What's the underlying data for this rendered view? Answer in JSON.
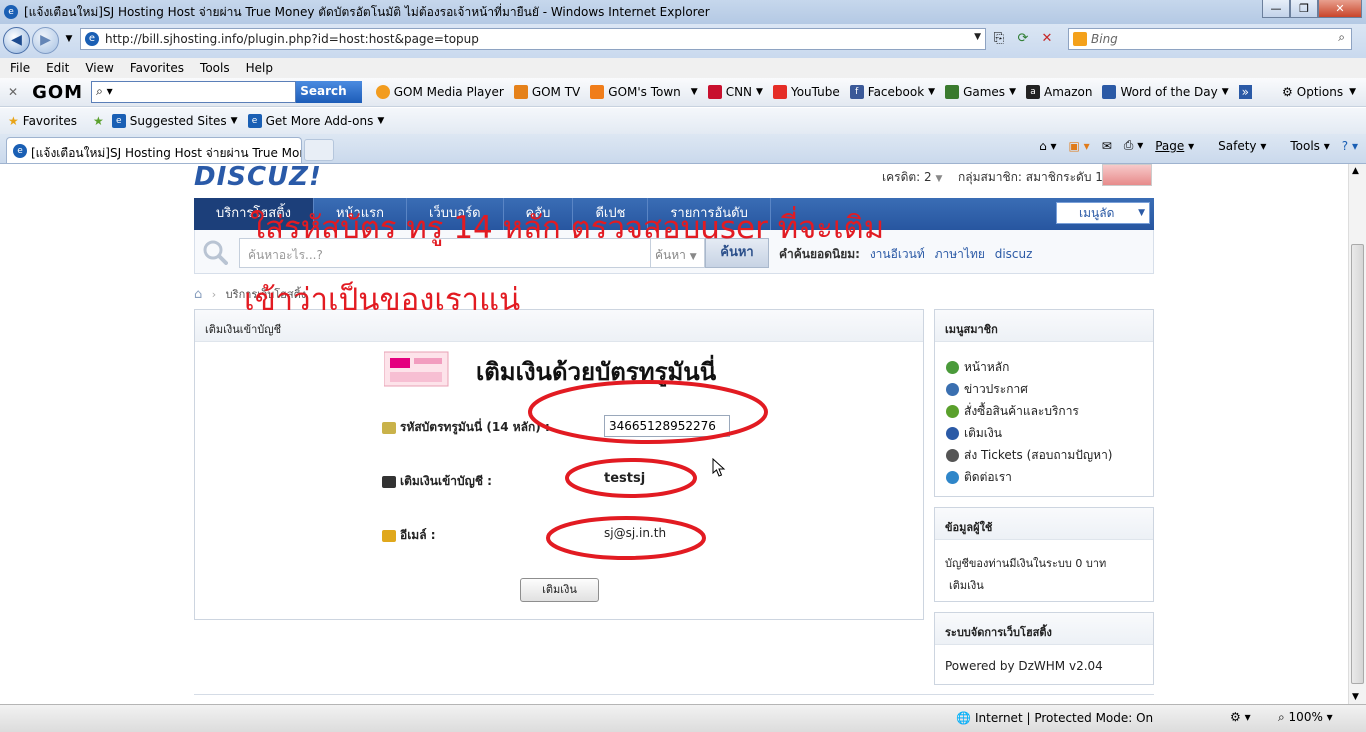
{
  "window": {
    "title": "[แจ้งเตือนใหม่]SJ Hosting Host จ่ายผ่าน True Money ตัดบัตรอัตโนมัติ ไม่ต้องรอเจ้าหน้าที่มายืนยั - Windows Internet Explorer"
  },
  "address": {
    "url": "http://bill.sjhosting.info/plugin.php?id=host:host&page=topup",
    "search_engine": "Bing"
  },
  "menubar": [
    "File",
    "Edit",
    "View",
    "Favorites",
    "Tools",
    "Help"
  ],
  "gombar": {
    "logo": "GOM",
    "search_label": "Search",
    "links": [
      "GOM Media Player",
      "GOM TV",
      "GOM's Town",
      "CNN",
      "YouTube",
      "Facebook",
      "Games",
      "Amazon",
      "Word of the Day"
    ],
    "options": "Options"
  },
  "favbar": {
    "favorites": "Favorites",
    "suggested": "Suggested Sites",
    "addons": "Get More Add-ons"
  },
  "tab": {
    "label": "[แจ้งเตือนใหม่]SJ Hosting Host จ่ายผ่าน True Mone..."
  },
  "commandbar": {
    "page": "Page",
    "safety": "Safety",
    "tools": "Tools"
  },
  "site": {
    "logo": "DISCUZ!",
    "credit": "เครดิต: 2",
    "member_group": "กลุ่มสมาชิก: สมาชิกระดับ 1",
    "nav": [
      "บริการโฮสติ้ง",
      "หน้าแรก",
      "เว็บบอร์ด",
      "คลับ",
      "ดีเปช",
      "รายการอันดับ"
    ],
    "member_menu": "เมนูลัด",
    "search_placeholder": "ค้นหาอะไร...?",
    "search_type": "ค้นหา",
    "search_button": "ค้นหา",
    "hot_label": "คำค้นยอดนิยม:",
    "hot_keywords": [
      "งานอีเวนท์",
      "ภาษาไทย",
      "discuz"
    ],
    "breadcrumb": "บริการเว็บโฮสติ้ง"
  },
  "main": {
    "header": "เติมเงินเข้าบัญชี",
    "banner_title": "เติมเงินด้วยบัตรทรูมันนี่",
    "card_label": "รหัสบัตรทรูมันนี่ (14 หลัก) :",
    "card_value": "34665128952276",
    "account_label": "เติมเงินเข้าบัญชี :",
    "account_value": "testsj",
    "email_label": "อีเมล์ :",
    "email_value": "sj@sj.in.th",
    "submit": "เติมเงิน"
  },
  "sidebar": {
    "menu_title": "เมนูสมาชิก",
    "menu_items": [
      "หน้าหลัก",
      "ข่าวประกาศ",
      "สั่งซื้อสินค้าและบริการ",
      "เติมเงิน",
      "ส่ง Tickets (สอบถามปัญหา)",
      "ติดต่อเรา"
    ],
    "user_title": "ข้อมูลผู้ใช้",
    "balance_text": "บัญชีของท่านมีเงินในระบบ 0 บาท",
    "topup_link": "เติมเงิน",
    "system_title": "ระบบจัดการเว็บโฮสติ้ง",
    "powered": "Powered by DzWHM v2.04"
  },
  "annotation": {
    "line1": "ใส่รหัสบัตร   ทรู   14 หลัก   ตรวจสอบuser ที่จะเติม",
    "line2": "เข้าว่าเป็นของเราแน่",
    "color": "#e21b22"
  },
  "status": {
    "zone": "Internet | Protected Mode: On",
    "zoom": "100%"
  }
}
